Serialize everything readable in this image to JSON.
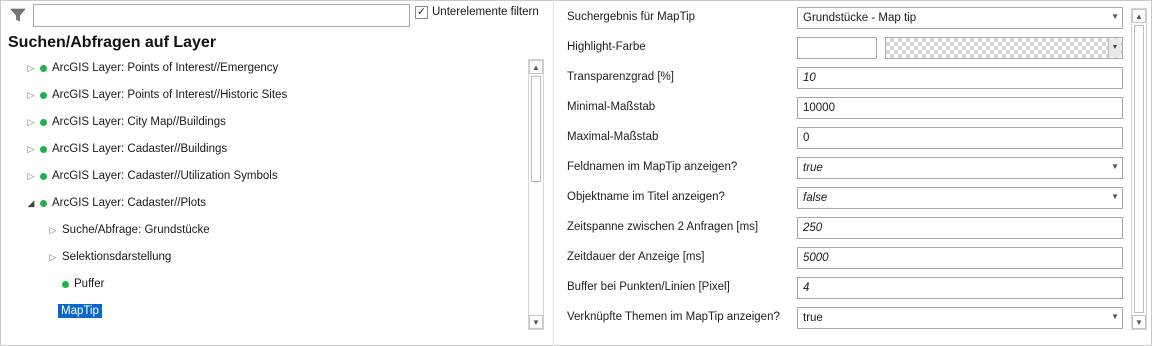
{
  "filter": {
    "placeholder": "",
    "checkbox_label": "Unterelemente filtern",
    "checkbox_checked": true
  },
  "left": {
    "title": "Suchen/Abfragen auf Layer",
    "tree": [
      {
        "label": "ArcGIS Layer: Points of Interest//Emergency",
        "expander": "collapsed",
        "dot": true
      },
      {
        "label": "ArcGIS Layer: Points of Interest//Historic Sites",
        "expander": "collapsed",
        "dot": true
      },
      {
        "label": "ArcGIS Layer: City Map//Buildings",
        "expander": "collapsed",
        "dot": true
      },
      {
        "label": "ArcGIS Layer: Cadaster//Buildings",
        "expander": "collapsed",
        "dot": true
      },
      {
        "label": "ArcGIS Layer: Cadaster//Utilization Symbols",
        "expander": "collapsed",
        "dot": true
      },
      {
        "label": "ArcGIS Layer: Cadaster//Plots",
        "expander": "expanded",
        "dot": true
      },
      {
        "label": "Suche/Abfrage: Grundstücke",
        "expander": "collapsed",
        "dot": false
      },
      {
        "label": "Selektionsdarstellung",
        "expander": "collapsed",
        "dot": false
      },
      {
        "label": "Puffer",
        "expander": "none",
        "dot": true
      },
      {
        "label": "MapTip",
        "expander": "none",
        "dot": false,
        "selected": true
      }
    ]
  },
  "properties": [
    {
      "label": "Suchergebnis für MapTip",
      "value": "Grundstücke - Map tip",
      "kind": "combo",
      "italic": false
    },
    {
      "label": "Highlight-Farbe",
      "value": "",
      "kind": "color",
      "italic": false
    },
    {
      "label": "Transparenzgrad [%]",
      "value": "10",
      "kind": "text",
      "italic": true
    },
    {
      "label": "Minimal-Maßstab",
      "value": "10000",
      "kind": "text",
      "italic": false
    },
    {
      "label": "Maximal-Maßstab",
      "value": "0",
      "kind": "text",
      "italic": false
    },
    {
      "label": "Feldnamen im MapTip anzeigen?",
      "value": "true",
      "kind": "combo",
      "italic": true
    },
    {
      "label": "Objektname im Titel anzeigen?",
      "value": "false",
      "kind": "combo",
      "italic": true
    },
    {
      "label": "Zeitspanne zwischen 2 Anfragen [ms]",
      "value": "250",
      "kind": "text",
      "italic": true
    },
    {
      "label": "Zeitdauer der Anzeige [ms]",
      "value": "5000",
      "kind": "text",
      "italic": true
    },
    {
      "label": "Buffer bei Punkten/Linien [Pixel]",
      "value": "4",
      "kind": "text",
      "italic": true
    },
    {
      "label": "Verknüpfte Themen im MapTip anzeigen?",
      "value": "true",
      "kind": "combo",
      "italic": false
    }
  ],
  "colors": {
    "selection": "#0a66c9",
    "status_dot": "#1db34a"
  },
  "icons": {
    "filter": "funnel-icon",
    "expand": "triangle-right-icon",
    "collapse": "triangle-down-icon",
    "combo": "chevron-down-icon"
  }
}
